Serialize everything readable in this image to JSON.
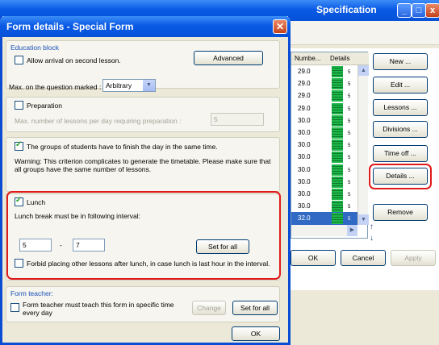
{
  "background_window": {
    "title": "Specification",
    "controls": [
      "_",
      "□",
      "x"
    ],
    "table": {
      "headers": [
        "Numbe...",
        "Details"
      ],
      "rows": [
        {
          "number": "29.0",
          "details": "5"
        },
        {
          "number": "29.0",
          "details": "5"
        },
        {
          "number": "29.0",
          "details": "5"
        },
        {
          "number": "29.0",
          "details": "5"
        },
        {
          "number": "30.0",
          "details": "5"
        },
        {
          "number": "30.0",
          "details": "5"
        },
        {
          "number": "30.0",
          "details": "5"
        },
        {
          "number": "30.0",
          "details": "5"
        },
        {
          "number": "30.0",
          "details": "5"
        },
        {
          "number": "30.0",
          "details": "5"
        },
        {
          "number": "30.0",
          "details": "5"
        },
        {
          "number": "30.0",
          "details": "5"
        },
        {
          "number": "32.0",
          "details": "5"
        }
      ]
    },
    "buttons": {
      "new": "New ...",
      "edit": "Edit ...",
      "lessons": "Lessons ...",
      "divisions": "Divisions ...",
      "time_off": "Time off ...",
      "details": "Details ...",
      "remove": "Remove",
      "ok": "OK",
      "cancel": "Cancel",
      "apply": "Apply"
    }
  },
  "dialog": {
    "title": "Form details - Special Form",
    "education_block": {
      "title": "Education block",
      "allow_arrival_label": "Allow arrival on second lesson.",
      "allow_arrival_checked": false,
      "advanced_button": "Advanced"
    },
    "max_question": {
      "label": "Max. on the question marked :",
      "value": "Arbitrary"
    },
    "preparation": {
      "label": "Preparation",
      "checked": false,
      "max_label": "Max. number of lessons per day requiring preparation :",
      "max_value": "5"
    },
    "finish_same_time": {
      "label": "The groups of students have to finish the day in the same time.",
      "checked": true,
      "warning": "Warning: This criterion complicates to generate the timetable. Please make sure that all groups have the same number of lessons."
    },
    "lunch": {
      "label": "Lunch",
      "checked": true,
      "interval_label": "Lunch break must be in following interval:",
      "from": "5",
      "separator": "-",
      "to": "7",
      "set_for_all": "Set for all",
      "forbid_label": "Forbid placing other lessons after lunch, in case lunch is last hour in the interval.",
      "forbid_checked": false
    },
    "form_teacher": {
      "title": "Form teacher:",
      "label_line1": "Form teacher must teach this form in specific time",
      "label_line2": "every day",
      "checked": false,
      "change_button": "Change",
      "set_for_all_button": "Set for all"
    },
    "ok_button": "OK"
  }
}
